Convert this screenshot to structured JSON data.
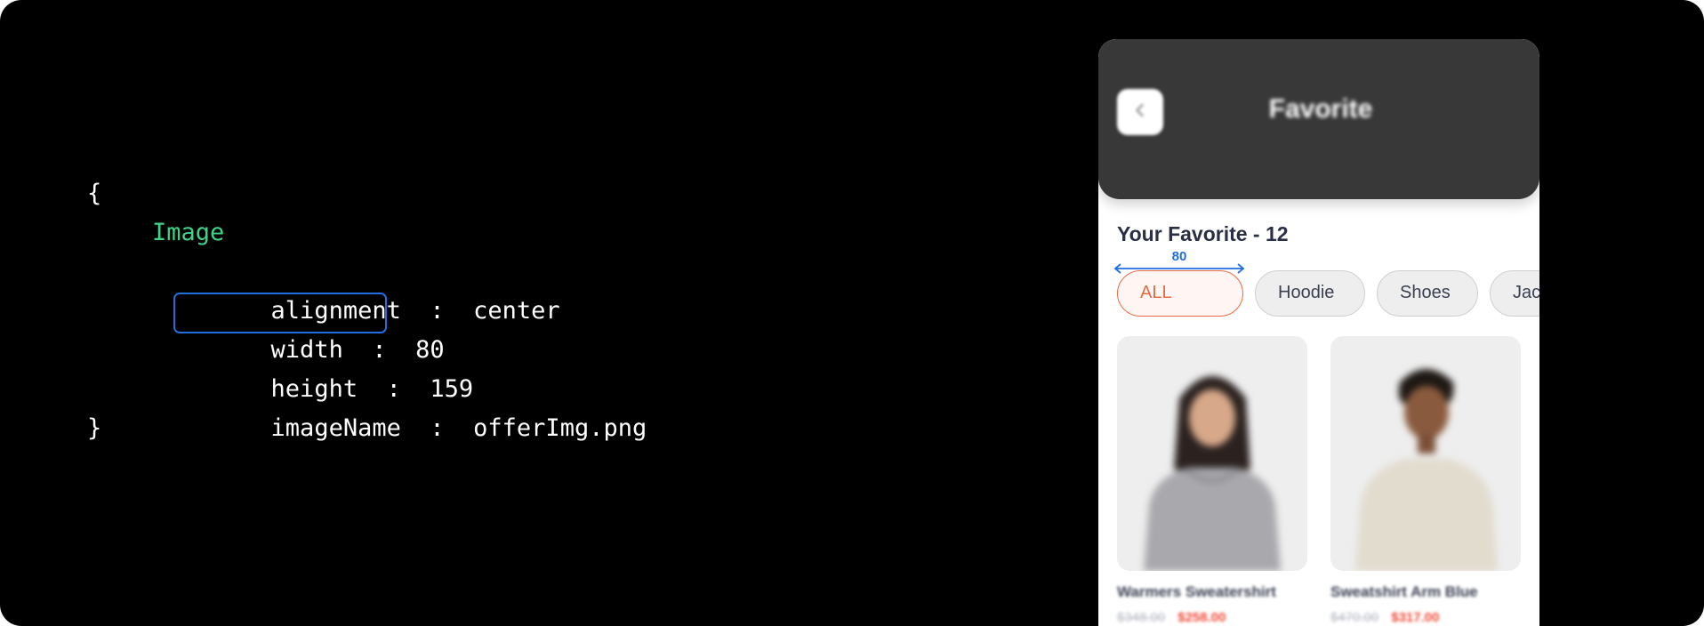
{
  "code": {
    "open_brace": "{",
    "close_brace": "}",
    "component": "Image",
    "properties": [
      {
        "key": "alignment",
        "sep": ":",
        "value": "center"
      },
      {
        "key": "width",
        "sep": ":",
        "value": "80"
      },
      {
        "key": "height",
        "sep": ":",
        "value": "159"
      },
      {
        "key": "imageName",
        "sep": ":",
        "value": "offerImg.png"
      }
    ],
    "highlighted_property": "width",
    "colors": {
      "component": "#3fd38a",
      "highlight": "#1f6fe0"
    }
  },
  "phone": {
    "header": {
      "title": "Favorite",
      "back_icon": "chevron-left-icon",
      "background": "#383838"
    },
    "section_title": "Your Favorite - 12",
    "measurement": {
      "label": "80"
    },
    "filters": [
      {
        "label": "ALL",
        "active": true
      },
      {
        "label": "Hoodie",
        "active": false
      },
      {
        "label": "Shoes",
        "active": false
      },
      {
        "label": "Jacket",
        "active": false
      }
    ],
    "products": [
      {
        "name": "Warmers Sweatershirt",
        "old_price": "$348.00",
        "price": "$258.00"
      },
      {
        "name": "Sweatshirt Arm Blue",
        "old_price": "$470.00",
        "price": "$317.00"
      }
    ],
    "colors": {
      "accent": "#e86a44",
      "sale": "#ef4b38"
    }
  }
}
